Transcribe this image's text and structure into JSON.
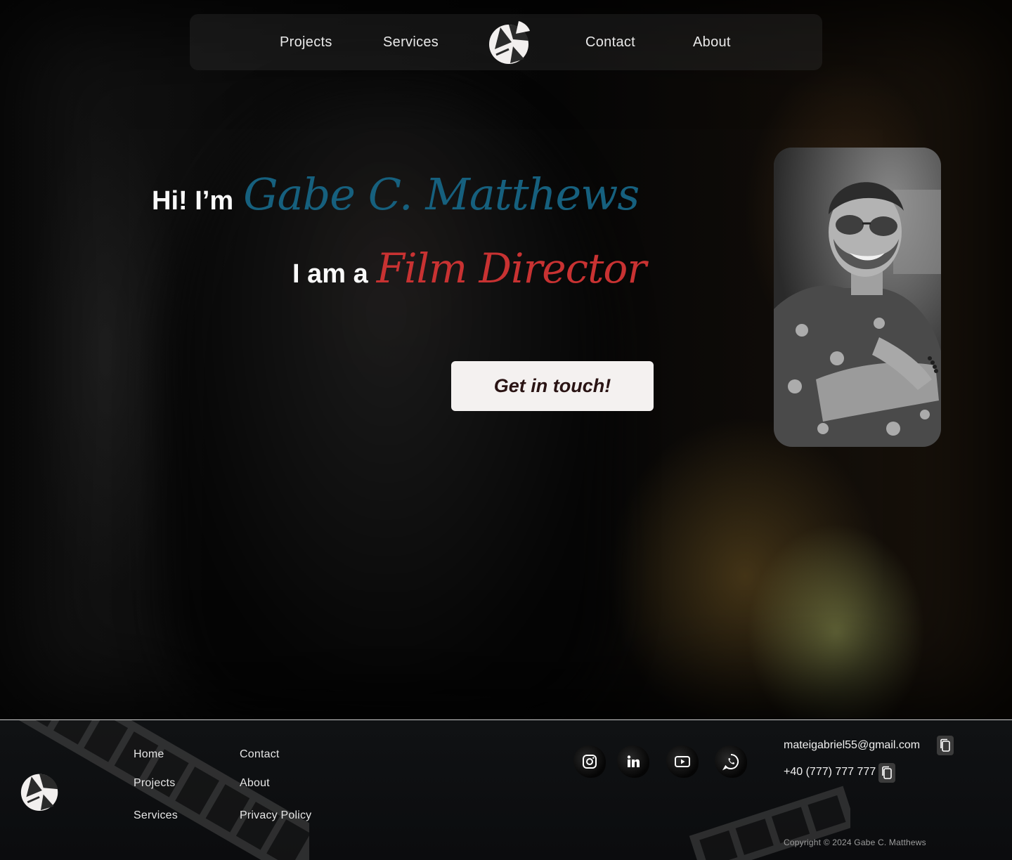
{
  "nav": {
    "items": [
      {
        "label": "Projects"
      },
      {
        "label": "Services"
      },
      {
        "label": "Contact"
      },
      {
        "label": "About"
      }
    ],
    "logo_icon": "aperture-logo-icon"
  },
  "hero": {
    "greeting": "Hi! I’m",
    "name": "Gabe C. Matthews",
    "role_prefix": "I am a",
    "role": "Film Director",
    "cta_label": "Get in touch!",
    "name_color": "#16607e",
    "role_color": "#c83232"
  },
  "portrait": {
    "icon": "portrait-photo"
  },
  "footer": {
    "links": [
      {
        "label": "Home"
      },
      {
        "label": "Contact"
      },
      {
        "label": "Projects"
      },
      {
        "label": "About"
      },
      {
        "label": "Services"
      },
      {
        "label": "Privacy Policy"
      }
    ],
    "socials": [
      {
        "icon": "instagram-icon"
      },
      {
        "icon": "linkedin-icon"
      },
      {
        "icon": "youtube-icon"
      },
      {
        "icon": "whatsapp-icon"
      }
    ],
    "email": "mateigabriel55@gmail.com",
    "phone": "+40 (777) 777 777",
    "copyright": "Copyright © 2024 Gabe C. Matthews"
  }
}
